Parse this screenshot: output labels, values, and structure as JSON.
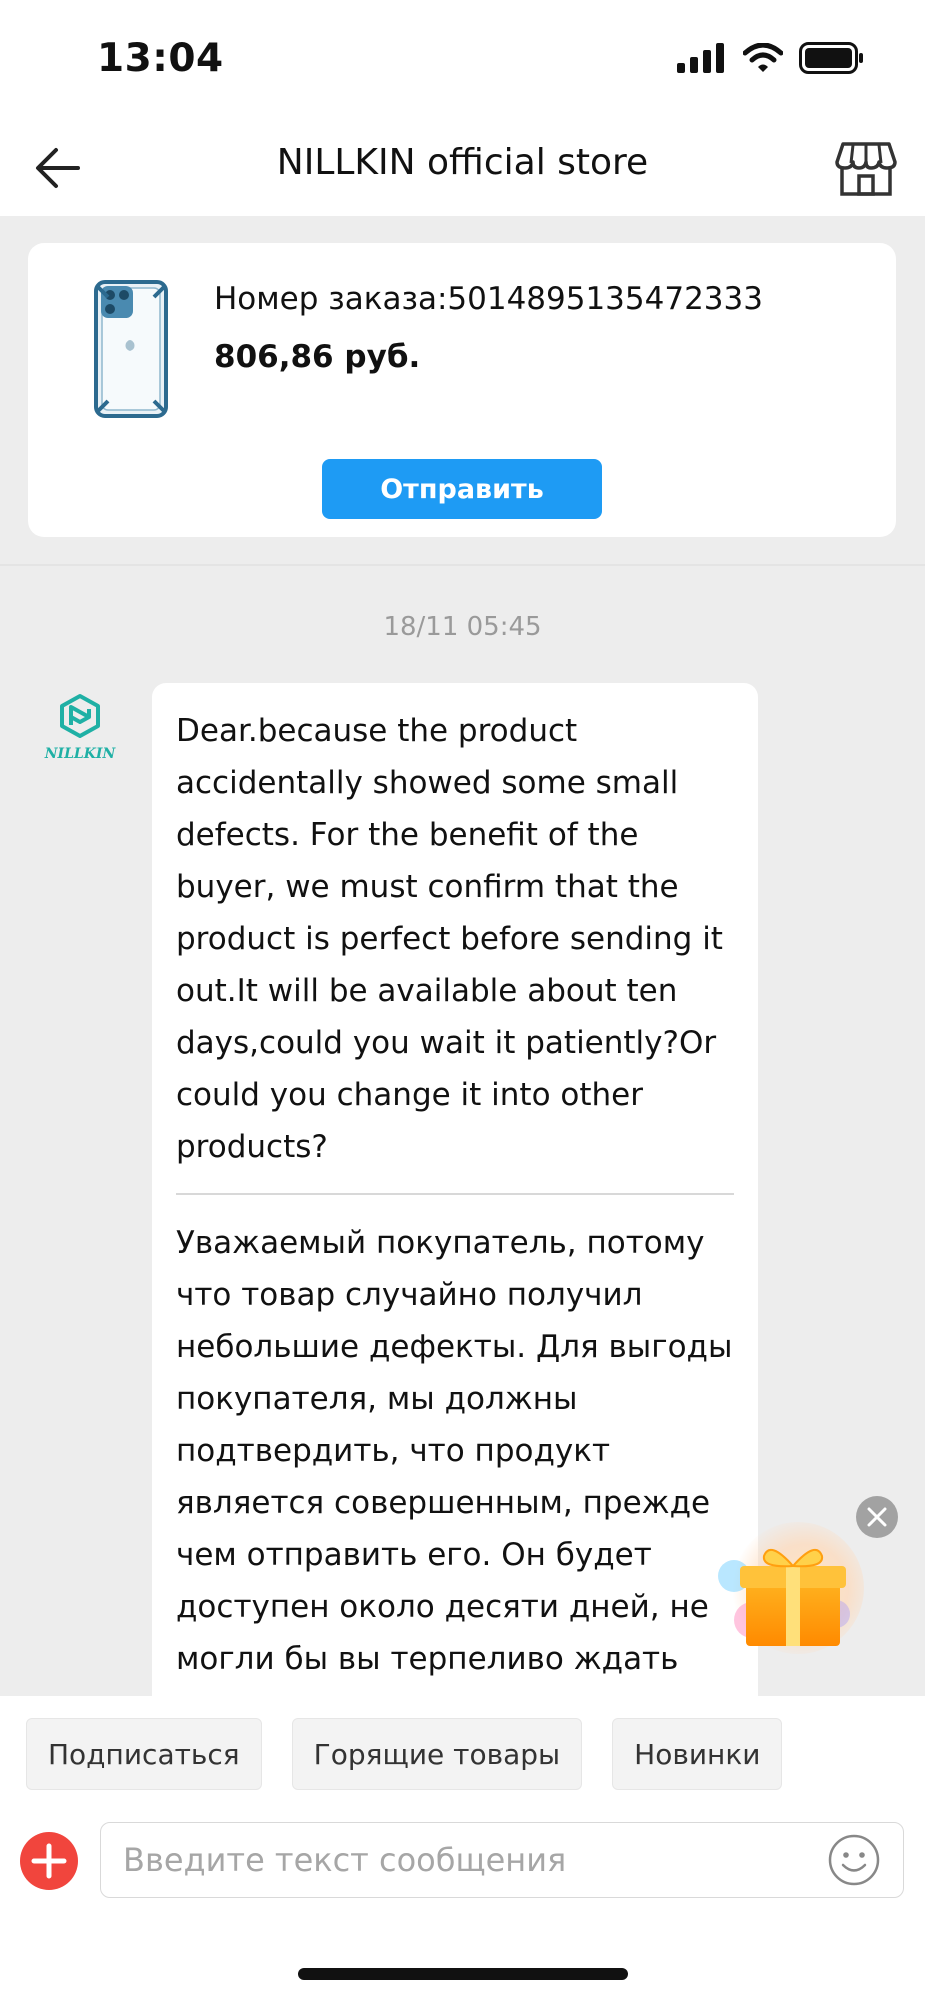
{
  "status_bar": {
    "time": "13:04",
    "icons": [
      "cellular-signal-icon",
      "wifi-icon",
      "battery-icon"
    ]
  },
  "nav": {
    "title": "NILLKIN official store",
    "back_icon": "arrow-left-icon",
    "store_icon": "storefront-icon"
  },
  "order": {
    "number_text": "Номер заказа:5014895135472333",
    "price": "806,86 руб.",
    "send_label": "Отправить",
    "thumbnail_icon": "phone-case-icon"
  },
  "chat": {
    "timestamp": "18/11 05:45",
    "avatar_icon": "nillkin-logo-icon",
    "avatar_logo_text": "NILLKIN",
    "message_en": "Dear.because the product accidentally showed some small defects. For the benefit of the buyer, we must confirm that the product is perfect before sending it out.It will be available about ten days,could you wait it patiently?Or could you change it into other products?",
    "message_ru": "Уважаемый покупатель, потому что товар случайно получил небольшие дефекты. Для выгоды покупателя, мы должны подтвердить, что продукт является совершенным, прежде чем отправить его. Он будет доступен около десяти дней, не могли бы вы терпеливо ждать"
  },
  "gift": {
    "icon": "gift-box-icon",
    "close_icon": "close-icon"
  },
  "quick_replies": [
    "Подписаться",
    "Горящие товары",
    "Новинки"
  ],
  "input": {
    "placeholder": "Введите текст сообщения",
    "plus_icon": "plus-icon",
    "emoji_icon": "smiley-icon"
  },
  "colors": {
    "accent_blue": "#1e9bf4",
    "plus_red": "#f1453d",
    "brand_teal": "#1fb0a5"
  }
}
